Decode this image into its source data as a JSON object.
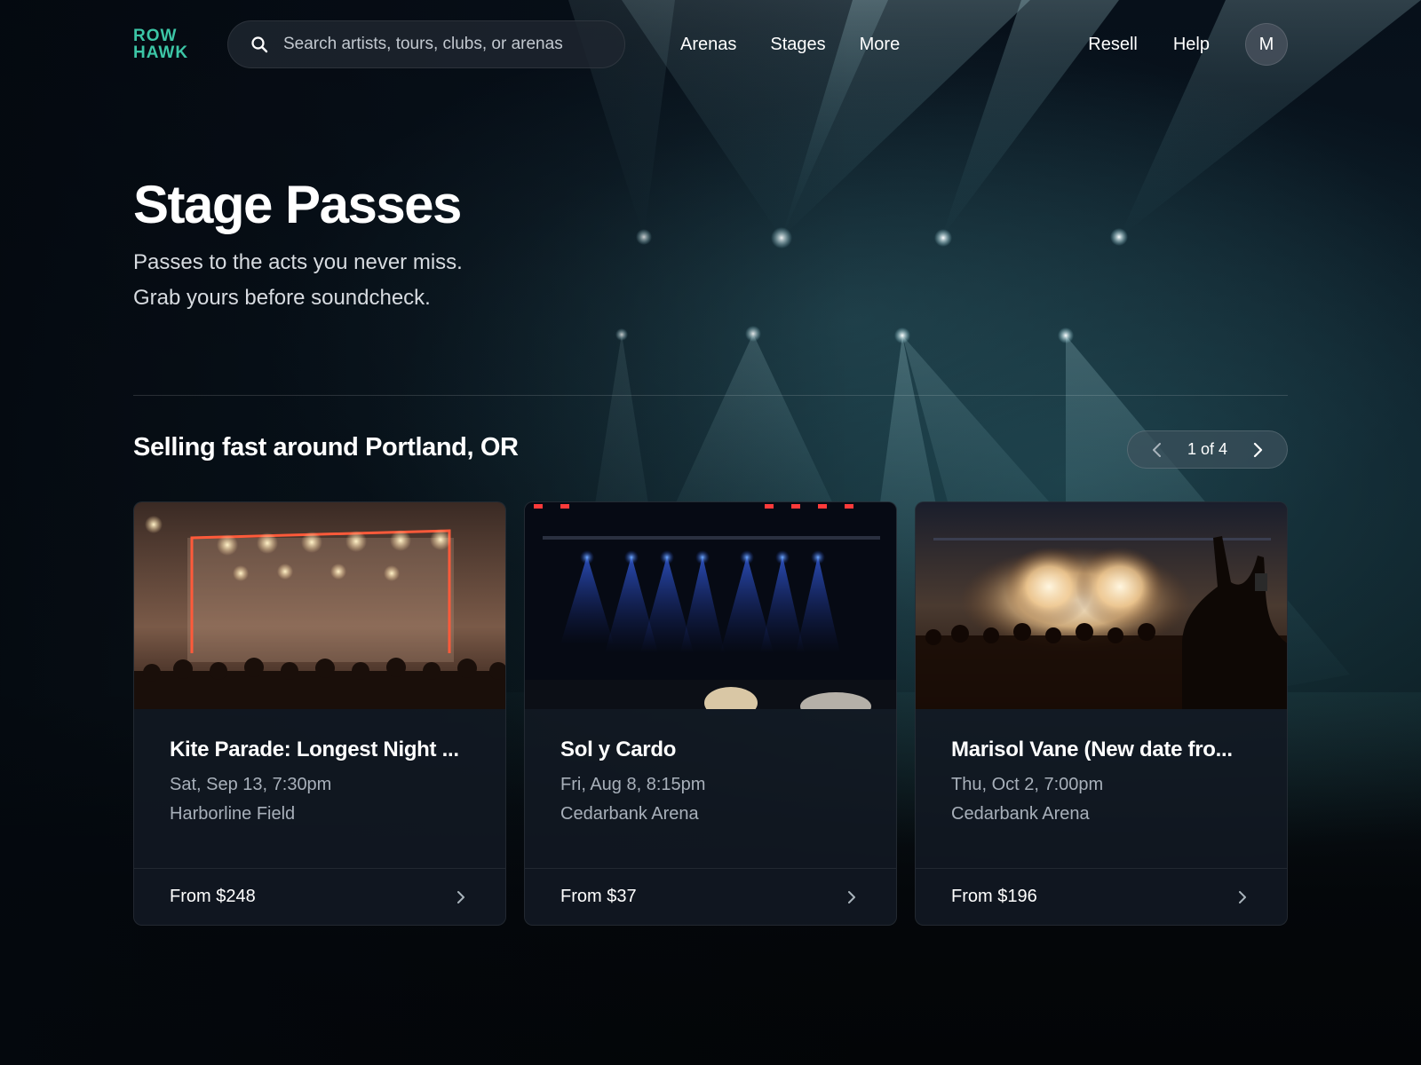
{
  "brand": {
    "line1": "ROW",
    "line2": "HAWK",
    "color": "#3cc6a6"
  },
  "search": {
    "placeholder": "Search artists, tours, clubs, or arenas",
    "value": "",
    "icon": "search-icon"
  },
  "nav": {
    "main": [
      "Arenas",
      "Stages",
      "More"
    ],
    "right": [
      "Resell",
      "Help"
    ],
    "avatar_initial": "M"
  },
  "hero": {
    "title": "Stage Passes",
    "subtitle_line1": "Passes to the acts you never miss.",
    "subtitle_line2": "Grab yours before soundcheck."
  },
  "section": {
    "title": "Selling fast around Portland, OR",
    "pager_text": "1 of 4",
    "prev_icon": "chevron-left-icon",
    "next_icon": "chevron-right-icon"
  },
  "cards": [
    {
      "title": "Kite Parade: Longest Night ...",
      "date": "Sat, Sep 13, 7:30pm",
      "venue": "Harborline Field",
      "price": "From $248",
      "image": "concert-stage-warm-lights"
    },
    {
      "title": "Sol y Cardo",
      "date": "Fri, Aug 8, 8:15pm",
      "venue": "Cedarbank Arena",
      "price": "From $37",
      "image": "concert-stage-blue-lights"
    },
    {
      "title": "Marisol Vane (New date fro...",
      "date": "Thu, Oct 2, 7:00pm",
      "venue": "Cedarbank Arena",
      "price": "From $196",
      "image": "concert-crowd-pyro"
    }
  ]
}
